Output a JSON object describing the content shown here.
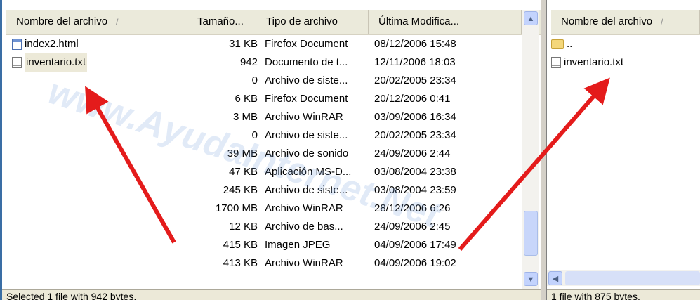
{
  "left_panel": {
    "columns": [
      "Nombre del archivo",
      "Tamaño...",
      "Tipo de archivo",
      "Última Modifica..."
    ],
    "sort_indicator": "/",
    "rows": [
      {
        "name": "index2.html",
        "icon": "html-file-icon",
        "size": "31 KB",
        "type": "Firefox Document",
        "date": "08/12/2006 15:48"
      },
      {
        "name": "inventario.txt",
        "icon": "text-file-icon",
        "size": "942",
        "type": "Documento de t...",
        "date": "12/11/2006 18:03",
        "selected": true
      },
      {
        "name": "",
        "size": "0",
        "type": "Archivo de siste...",
        "date": "20/02/2005 23:34"
      },
      {
        "name": "",
        "size": "6 KB",
        "type": "Firefox Document",
        "date": "20/12/2006 0:41"
      },
      {
        "name": "",
        "size": "3 MB",
        "type": "Archivo WinRAR",
        "date": "03/09/2006 16:34"
      },
      {
        "name": "",
        "size": "0",
        "type": "Archivo de siste...",
        "date": "20/02/2005 23:34"
      },
      {
        "name": "",
        "size": "39 MB",
        "type": "Archivo de sonido",
        "date": "24/09/2006 2:44"
      },
      {
        "name": "",
        "size": "47 KB",
        "type": "Aplicación MS-D...",
        "date": "03/08/2004 23:38"
      },
      {
        "name": "",
        "size": "245 KB",
        "type": "Archivo de siste...",
        "date": "03/08/2004 23:59"
      },
      {
        "name": "",
        "size": "1700 MB",
        "type": "Archivo WinRAR",
        "date": "28/12/2006 6:26"
      },
      {
        "name": "",
        "size": "12 KB",
        "type": "Archivo de bas...",
        "date": "24/09/2006 2:45"
      },
      {
        "name": "",
        "size": "415 KB",
        "type": "Imagen JPEG",
        "date": "04/09/2006 17:49"
      },
      {
        "name": "",
        "size": "413 KB",
        "type": "Archivo WinRAR",
        "date": "04/09/2006 19:02"
      }
    ],
    "status": "Selected 1 file with 942 bytes."
  },
  "right_panel": {
    "columns": [
      "Nombre del archivo"
    ],
    "sort_indicator": "/",
    "rows": [
      {
        "name": "..",
        "icon": "folder-icon"
      },
      {
        "name": "inventario.txt",
        "icon": "text-file-icon"
      }
    ],
    "status": "1 file with 875 bytes."
  },
  "watermark": "www.AyudaInternet.Net",
  "colors": {
    "arrow": "#e41b1b",
    "panel_border": "#3a6ea5",
    "header_bg": "#ebeadb"
  }
}
